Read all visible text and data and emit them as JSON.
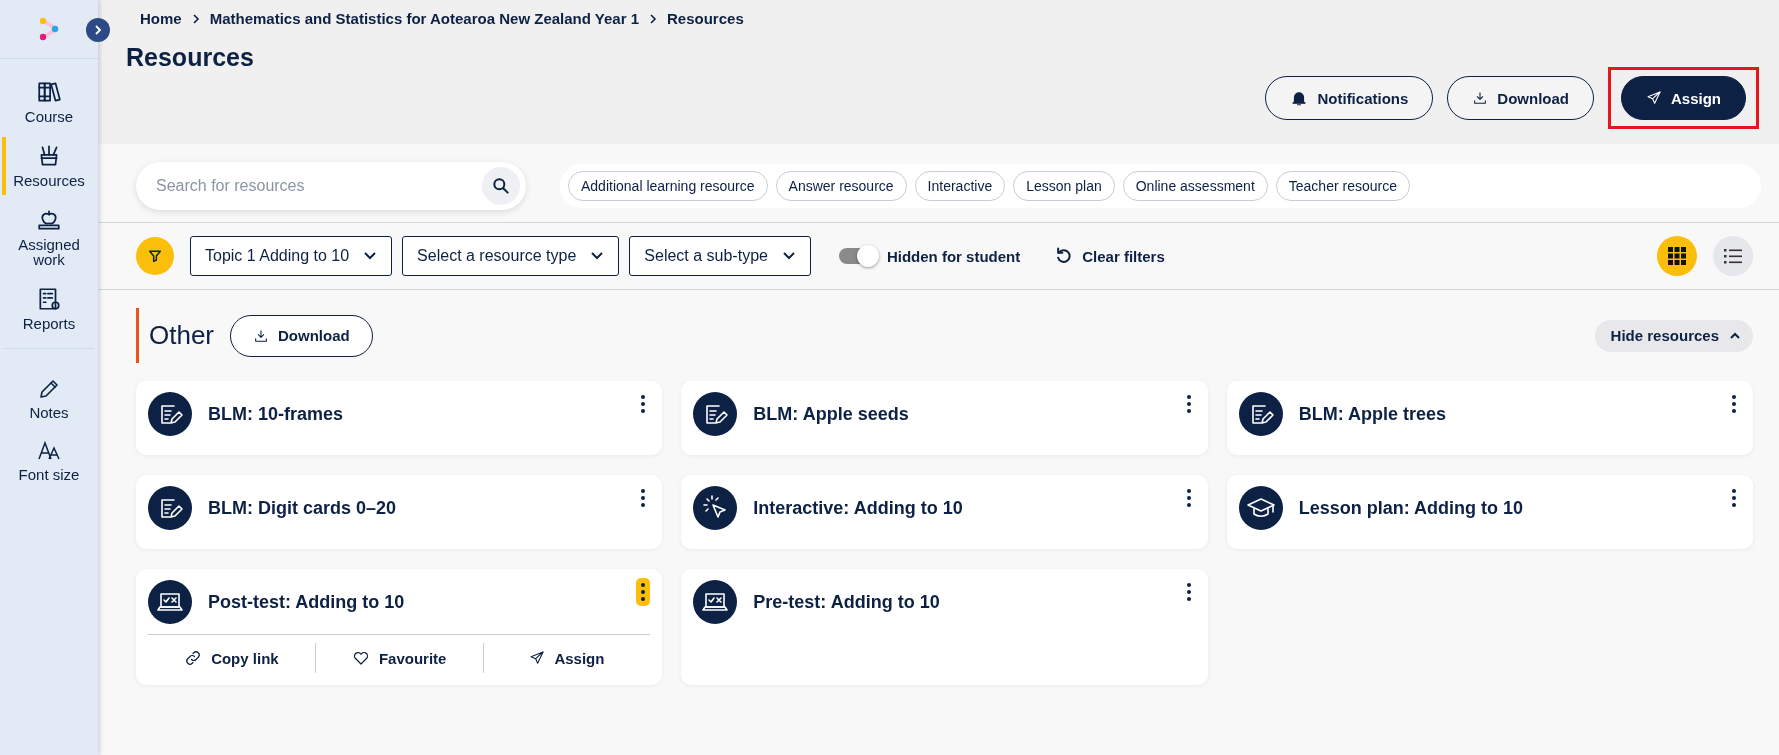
{
  "sidebar": {
    "nav_items": [
      {
        "label": "Course",
        "kind": "books",
        "selected": false
      },
      {
        "label": "Resources",
        "kind": "pencil-cup",
        "selected": true
      },
      {
        "label": "Assigned work",
        "kind": "apple",
        "selected": false
      },
      {
        "label": "Reports",
        "kind": "report",
        "selected": false
      }
    ],
    "tool_items": [
      {
        "label": "Notes",
        "kind": "pencil"
      },
      {
        "label": "Font size",
        "kind": "font"
      }
    ]
  },
  "breadcrumb": [
    "Home",
    "Mathematics and Statistics for Aotearoa New Zealand Year 1",
    "Resources"
  ],
  "page_title": "Resources",
  "header_buttons": [
    {
      "label": "Notifications",
      "kind": "bell",
      "primary": false,
      "highlighted": false
    },
    {
      "label": "Download",
      "kind": "download",
      "primary": false,
      "highlighted": false
    },
    {
      "label": "Assign",
      "kind": "send",
      "primary": true,
      "highlighted": true
    }
  ],
  "search": {
    "placeholder": "Search for resources"
  },
  "type_chips": [
    "Additional learning resource",
    "Answer resource",
    "Interactive",
    "Lesson plan",
    "Online assessment",
    "Teacher resource"
  ],
  "filters": {
    "dropdowns": [
      "Topic 1 Adding to 10",
      "Select a resource type",
      "Select a sub-type"
    ],
    "hidden_toggle": {
      "label": "Hidden for student",
      "on": true
    },
    "clear_filters": "Clear filters"
  },
  "view_modes": [
    {
      "kind": "grid",
      "selected": true
    },
    {
      "kind": "list",
      "selected": false
    }
  ],
  "section": {
    "title": "Other",
    "download": "Download",
    "hide_label": "Hide resources",
    "expanded": true
  },
  "resources": [
    {
      "title": "BLM: 10-frames",
      "kind": "document",
      "expanded": false
    },
    {
      "title": "BLM: Apple seeds",
      "kind": "document",
      "expanded": false
    },
    {
      "title": "BLM: Apple trees",
      "kind": "document",
      "expanded": false
    },
    {
      "title": "BLM: Digit cards 0–20",
      "kind": "document",
      "expanded": false
    },
    {
      "title": "Interactive: Adding to 10",
      "kind": "cursor",
      "expanded": false
    },
    {
      "title": "Lesson plan: Adding to 10",
      "kind": "cap",
      "expanded": false
    },
    {
      "title": "Post-test: Adding to 10",
      "kind": "laptop",
      "expanded": true,
      "actions": [
        {
          "label": "Copy link",
          "kind": "link"
        },
        {
          "label": "Favourite",
          "kind": "heart"
        },
        {
          "label": "Assign",
          "kind": "send"
        }
      ]
    },
    {
      "title": "Pre-test: Adding to 10",
      "kind": "laptop",
      "expanded": false
    }
  ]
}
